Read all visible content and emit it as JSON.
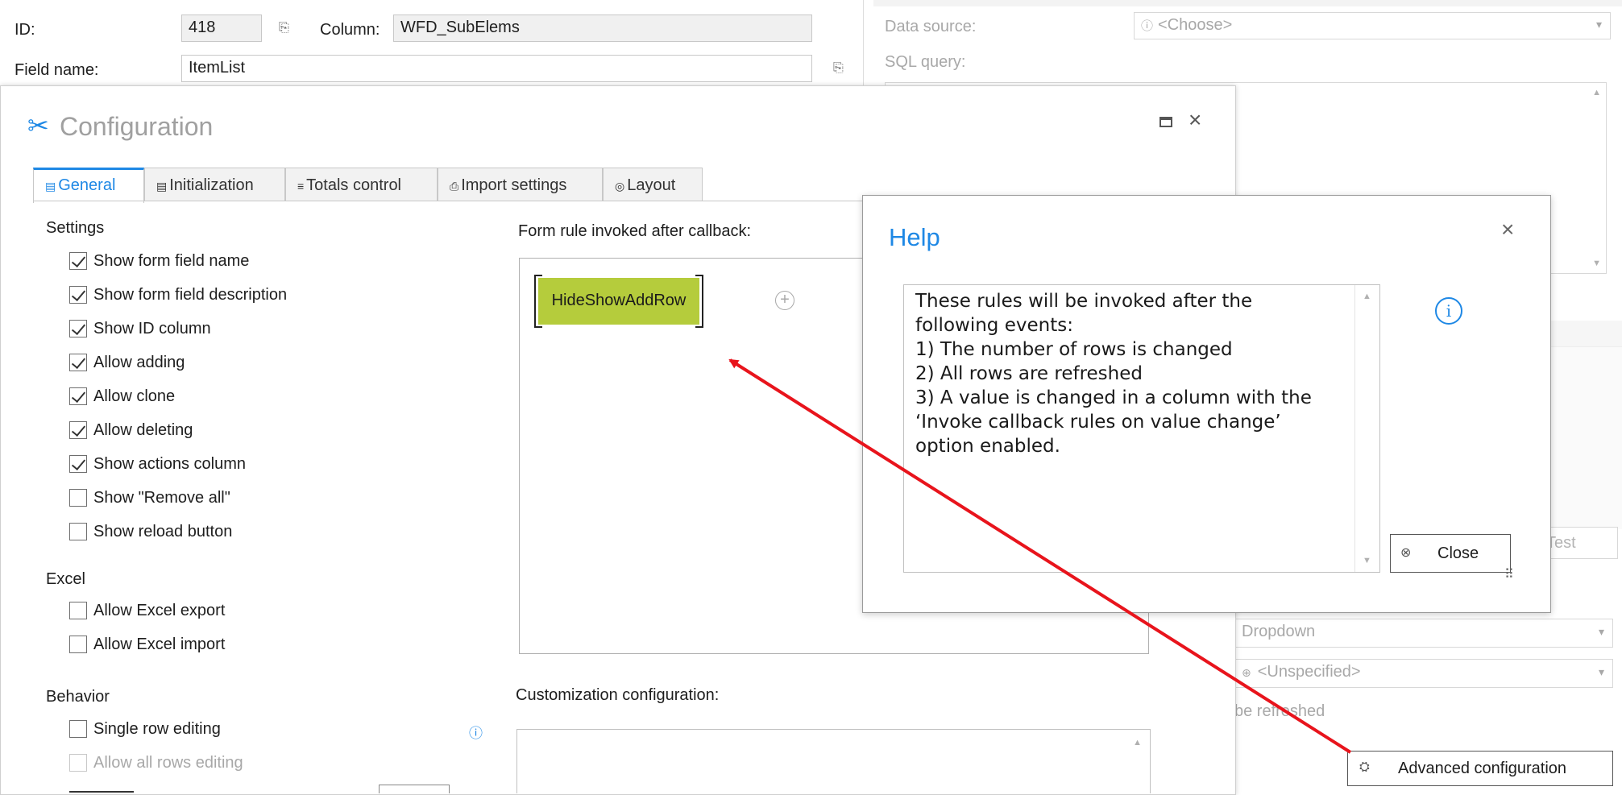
{
  "top_form": {
    "id_label": "ID:",
    "id_value": "418",
    "column_label": "Column:",
    "column_value": "WFD_SubElems",
    "field_name_label": "Field name:",
    "field_name_value": "ItemList"
  },
  "right_panel": {
    "data_source_label": "Data source:",
    "data_source_value": "<Choose>",
    "sql_query_label": "SQL query:",
    "test_button_label": "Test",
    "dropdown_value": "Dropdown",
    "unspecified_value": "<Unspecified>",
    "refreshed_text": "be refreshed",
    "advanced_config_label": "Advanced configuration"
  },
  "config_dialog": {
    "title": "Configuration",
    "tabs": [
      {
        "label": "General",
        "active": true
      },
      {
        "label": "Initialization",
        "active": false
      },
      {
        "label": "Totals control",
        "active": false
      },
      {
        "label": "Import settings",
        "active": false
      },
      {
        "label": "Layout",
        "active": false
      }
    ],
    "settings_title": "Settings",
    "settings": [
      {
        "label": "Show form field name",
        "checked": true
      },
      {
        "label": "Show form field description",
        "checked": true
      },
      {
        "label": "Show ID column",
        "checked": true
      },
      {
        "label": "Allow adding",
        "checked": true
      },
      {
        "label": "Allow clone",
        "checked": true
      },
      {
        "label": "Allow deleting",
        "checked": true
      },
      {
        "label": "Show actions column",
        "checked": true
      },
      {
        "label": "Show \"Remove all\"",
        "checked": false
      },
      {
        "label": "Show reload button",
        "checked": false
      }
    ],
    "excel_title": "Excel",
    "excel": [
      {
        "label": "Allow Excel export",
        "checked": false
      },
      {
        "label": "Allow Excel import",
        "checked": false
      }
    ],
    "behavior_title": "Behavior",
    "behavior": [
      {
        "label": "Single row editing",
        "checked": false,
        "disabled": false
      },
      {
        "label": "Allow all rows editing",
        "checked": false,
        "disabled": true
      }
    ],
    "form_rule_label": "Form rule invoked after callback:",
    "rule_name": "HideShowAddRow",
    "rule_color": "#b5cc3c",
    "customization_label": "Customization configuration:"
  },
  "help_dialog": {
    "title": "Help",
    "lines": [
      "These rules will be invoked after the",
      "following events:",
      "1) The number of rows is changed",
      "2) All rows are refreshed",
      "3) A value is changed in a column with the",
      "‘Invoke callback rules on value change’",
      "option enabled."
    ],
    "close_label": "Close",
    "accent": "#1e88e5"
  },
  "annotation": {
    "arrow_color": "#e8141c"
  }
}
